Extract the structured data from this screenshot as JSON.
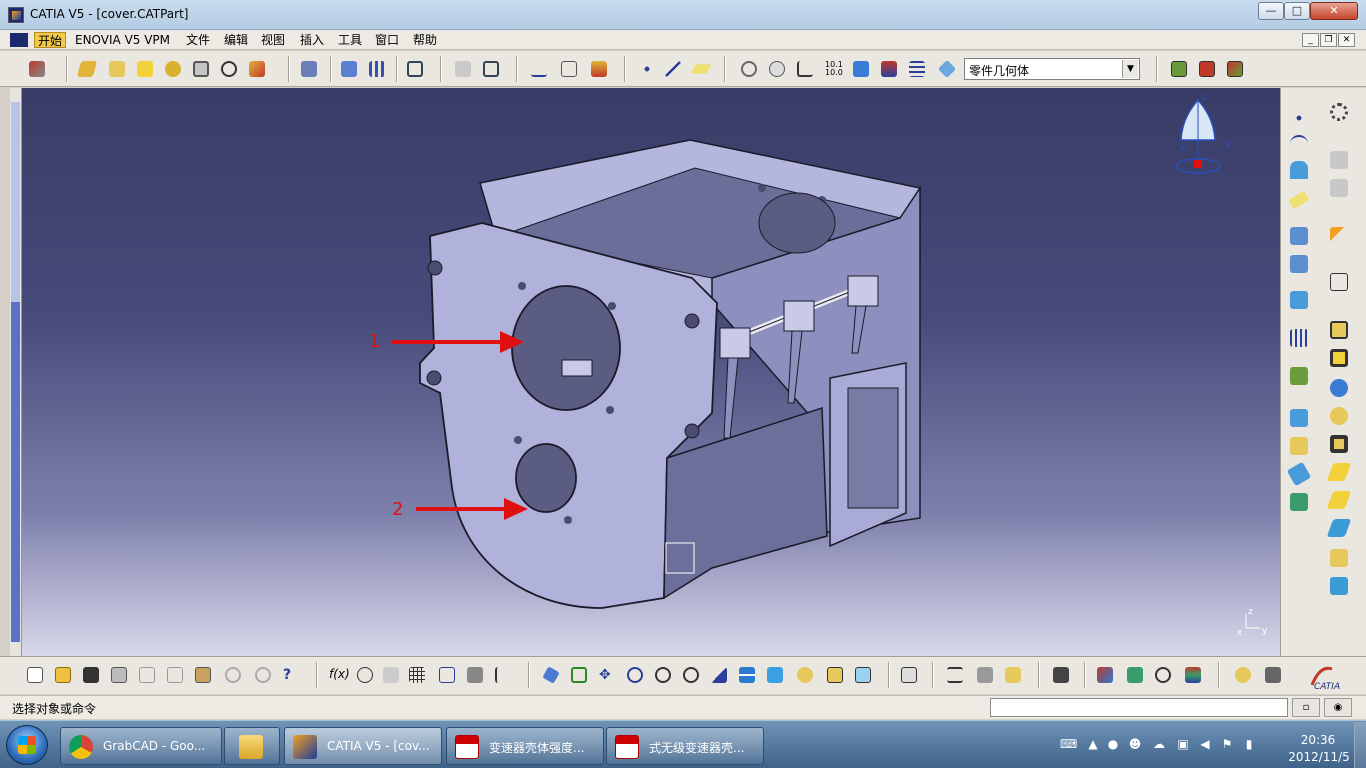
{
  "window": {
    "title": "CATIA V5 - [cover.CATPart]",
    "min": "—",
    "max": "□",
    "close": "✕"
  },
  "menu": {
    "items": [
      "开始",
      "ENOVIA V5 VPM",
      "文件",
      "编辑",
      "视图",
      "插入",
      "工具",
      "窗口",
      "帮助"
    ],
    "active_index": 0
  },
  "mdi": {
    "min": "_",
    "restore": "❐",
    "close": "✕"
  },
  "toolbar": {
    "geometry_select": "零件几何体"
  },
  "annotations": {
    "label_1": "1",
    "label_2": "2"
  },
  "compass": {
    "z": "z",
    "x": "x",
    "y": "y"
  },
  "triad": {
    "z": "z",
    "x": "x",
    "y": "y"
  },
  "status": {
    "prompt": "选择对象或命令",
    "command_value": ""
  },
  "taskbar": {
    "tasks": [
      {
        "label": "GrabCAD - Goo...",
        "icon": "chrome-icon"
      },
      {
        "label": "",
        "icon": "folder-icon"
      },
      {
        "label": "CATIA V5 - [cov...",
        "icon": "catia-icon"
      },
      {
        "label": "变速器壳体强度...",
        "icon": "pdf-icon"
      },
      {
        "label": "式无级变速器壳...",
        "icon": "pdf-icon"
      }
    ],
    "time": "20:36",
    "date": "2012/11/5"
  },
  "colors": {
    "accent_red": "#e01010",
    "viewport_top": "#383c66",
    "viewport_bottom": "#d8d8ea",
    "part_fill": "#a9abd6"
  }
}
